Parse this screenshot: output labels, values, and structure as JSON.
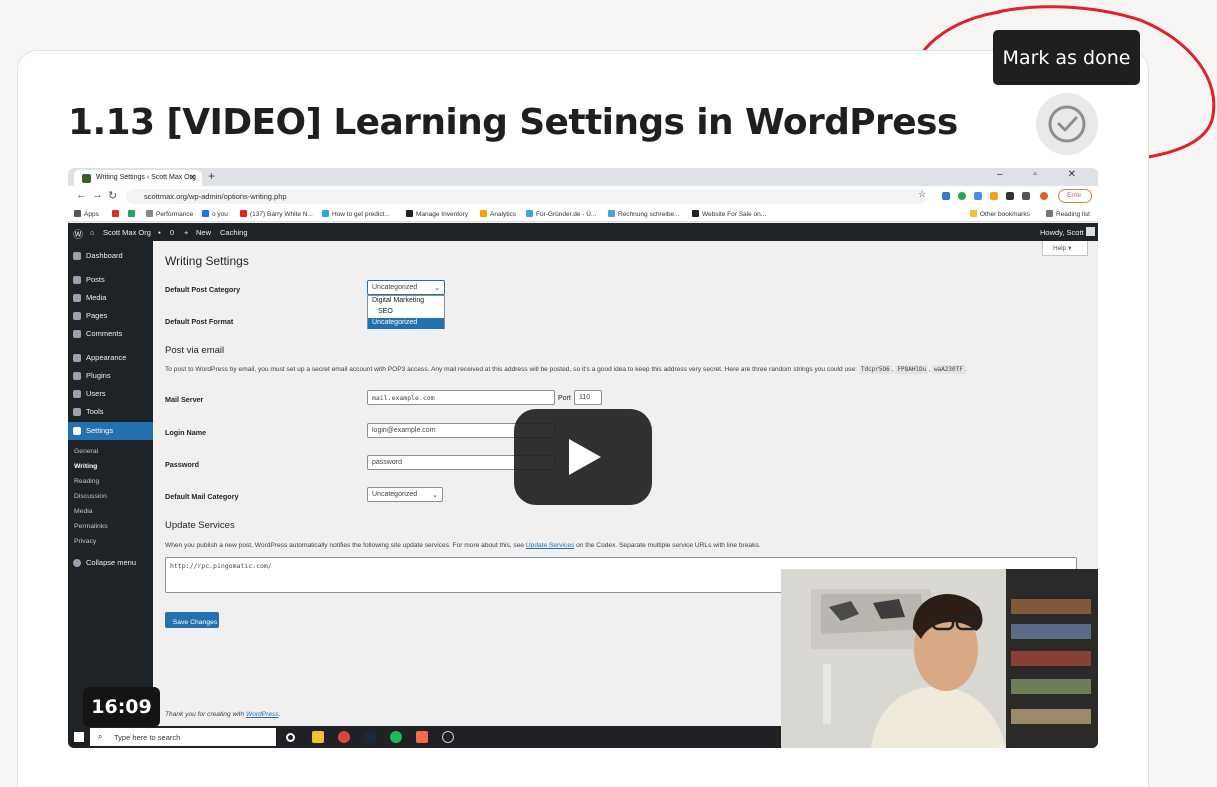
{
  "lesson": {
    "title": "1.13 [VIDEO] Learning Settings in WordPress",
    "mark_done_tooltip": "Mark as done"
  },
  "video": {
    "duration": "16:09",
    "browser": {
      "tab_title": "Writing Settings ‹ Scott Max Org",
      "url": "scottmax.org/wp-admin/options-writing.php",
      "error_label": "Error",
      "bookmarks": [
        "Apps",
        "Performance",
        "o you",
        "(137) Barry White N...",
        "How to get predict...",
        "Manage Inventory",
        "Analytics",
        "Für-Gründer.de - Ü...",
        "Rechnung schreibe...",
        "Website For Sale on...",
        "Other bookmarks",
        "Reading list"
      ]
    },
    "wp_admin_bar": {
      "site_name": "Scott Max Org",
      "comments_count": "0",
      "new_label": "New",
      "caching_label": "Caching",
      "howdy": "Howdy, Scott"
    },
    "sidebar": {
      "items": [
        "Dashboard",
        "Posts",
        "Media",
        "Pages",
        "Comments",
        "Appearance",
        "Plugins",
        "Users",
        "Tools",
        "Settings"
      ],
      "submenu": [
        "General",
        "Writing",
        "Reading",
        "Discussion",
        "Media",
        "Permalinks",
        "Privacy"
      ],
      "collapse": "Collapse menu"
    },
    "settings": {
      "page_title": "Writing Settings",
      "help": "Help ▾",
      "default_post_category_label": "Default Post Category",
      "default_post_category_value": "Uncategorized",
      "category_options": [
        "Digital Marketing",
        "SEO",
        "Uncategorized"
      ],
      "default_post_format_label": "Default Post Format",
      "post_via_email_heading": "Post via email",
      "post_via_email_desc": "To post to WordPress by email, you must set up a secret email account with POP3 access. Any mail received at this address will be posted, so it's a good idea to keep this address very secret. Here are three random strings you could use:",
      "random_strings": [
        "Tdcpr5O6",
        "FP8AHlDu",
        "waA230TF"
      ],
      "mail_server_label": "Mail Server",
      "mail_server_value": "mail.example.com",
      "port_label": "Port",
      "port_value": "110",
      "login_name_label": "Login Name",
      "login_name_value": "login@example.com",
      "password_label": "Password",
      "password_value": "password",
      "default_mail_category_label": "Default Mail Category",
      "default_mail_category_value": "Uncategorized",
      "update_services_heading": "Update Services",
      "update_services_desc_pre": "When you publish a new post, WordPress automatically notifies the following site update services. For more about this, see",
      "update_services_link": "Update Services",
      "update_services_desc_post": "on the Codex. Separate multiple service URLs with line breaks.",
      "ping_url": "http://rpc.pingomatic.com/",
      "save_button": "Save Changes",
      "footer_pre": "Thank you for creating with",
      "footer_link": "WordPress"
    },
    "taskbar": {
      "search_placeholder": "Type here to search"
    }
  },
  "colors": {
    "wp_blue": "#2271b1",
    "wp_dark": "#1d2327",
    "annotation_red": "#e0202a"
  }
}
